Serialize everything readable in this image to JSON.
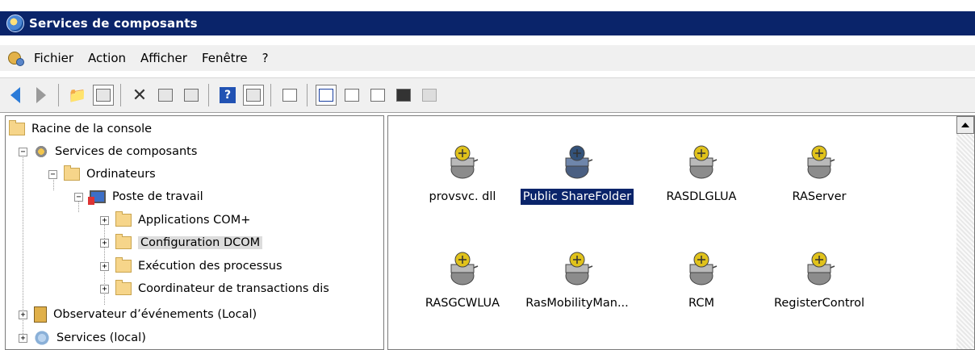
{
  "window": {
    "title": "Services de composants"
  },
  "menu": [
    "Fichier",
    "Action",
    "Afficher",
    "Fenêtre",
    "?"
  ],
  "tree": [
    {
      "label": "Racine de la console",
      "icon": "folder-icon",
      "level": 0,
      "expander": ""
    },
    {
      "label": "Services de composants",
      "icon": "component-services-icon",
      "level": 1,
      "expander": "−"
    },
    {
      "label": "Ordinateurs",
      "icon": "folder-icon",
      "level": 2,
      "expander": "−"
    },
    {
      "label": "Poste de travail",
      "icon": "computer-icon",
      "level": 3,
      "expander": "−"
    },
    {
      "label": "Applications COM+",
      "icon": "folder-icon",
      "level": 4,
      "expander": "+"
    },
    {
      "label": "Configuration DCOM",
      "icon": "folder-icon",
      "level": 4,
      "expander": "+",
      "selected": true
    },
    {
      "label": "Exécution des processus",
      "icon": "folder-icon",
      "level": 4,
      "expander": "+"
    },
    {
      "label": "Coordinateur de transactions dis",
      "icon": "folder-icon",
      "level": 4,
      "expander": "+"
    },
    {
      "label": "Observateur d’événements (Local)",
      "icon": "event-viewer-icon",
      "level": 0,
      "expander": "+"
    },
    {
      "label": "Services (local)",
      "icon": "services-icon",
      "level": 0,
      "expander": "+"
    }
  ],
  "components": [
    {
      "label": "provsvc. dll",
      "selected": false
    },
    {
      "label": "Public ShareFolder",
      "selected": true
    },
    {
      "label": "RASDLGLUA",
      "selected": false
    },
    {
      "label": "RAServer",
      "selected": false
    },
    {
      "label": "RASGCWLUA",
      "selected": false
    },
    {
      "label": "RasMobilityMan...",
      "selected": false
    },
    {
      "label": "RCM",
      "selected": false
    },
    {
      "label": "RegisterControl",
      "selected": false
    }
  ],
  "colors": {
    "titlebar": "#0a246a",
    "selection": "#0a246a"
  }
}
